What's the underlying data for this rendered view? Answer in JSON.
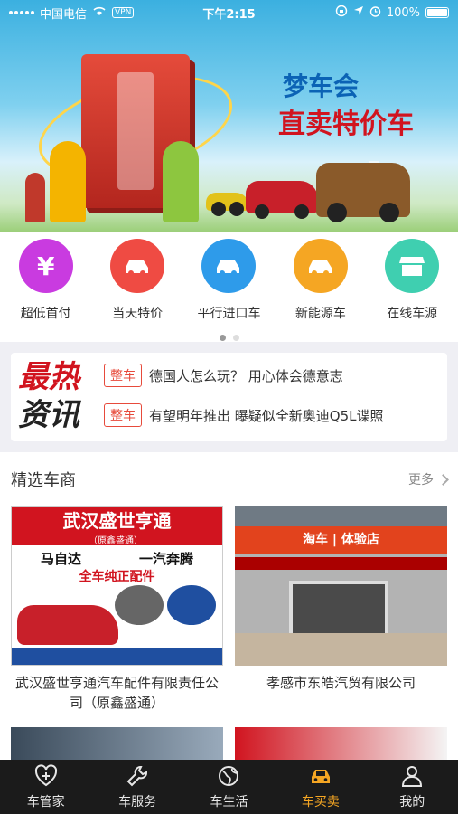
{
  "status_bar": {
    "carrier": "中国电信",
    "vpn": "VPN",
    "time": "下午2:15",
    "battery": "100%"
  },
  "banner": {
    "title_line1": "梦车会",
    "title_line2": "直卖特价车"
  },
  "categories": [
    {
      "label": "超低首付",
      "icon": "yen-icon",
      "color": "#c93be0"
    },
    {
      "label": "当天特价",
      "icon": "car-price-icon",
      "color": "#ef4b43"
    },
    {
      "label": "平行进口车",
      "icon": "car-import-icon",
      "color": "#2e9bea"
    },
    {
      "label": "新能源车",
      "icon": "car-energy-icon",
      "color": "#f5a623"
    },
    {
      "label": "在线车源",
      "icon": "store-icon",
      "color": "#3fcfb0"
    }
  ],
  "news": {
    "logo_line1": "最热",
    "logo_line2": "资讯",
    "items": [
      {
        "tag": "整车",
        "text": "德国人怎么玩？ 用心体会德意志"
      },
      {
        "tag": "整车",
        "text": "有望明年推出 曝疑似全新奥迪Q5L谍照"
      }
    ]
  },
  "dealers": {
    "title": "精选车商",
    "more": "更多",
    "items": [
      {
        "name": "武汉盛世亨通汽车配件有限责任公司（原鑫盛通）",
        "image": {
          "header": "武汉盛世亨通",
          "subheader": "（原鑫盛通）",
          "brand1": "马自达",
          "brand2": "一汽奔腾",
          "parts": "全车纯正配件"
        }
      },
      {
        "name": "孝感市东皓汽贸有限公司",
        "image": {
          "sign": "淘车 | 体验店"
        }
      }
    ]
  },
  "tabbar": [
    {
      "label": "车管家",
      "icon": "heart-plus-icon",
      "active": false
    },
    {
      "label": "车服务",
      "icon": "wrench-icon",
      "active": false
    },
    {
      "label": "车生活",
      "icon": "globe-icon",
      "active": false
    },
    {
      "label": "车买卖",
      "icon": "car-icon",
      "active": true
    },
    {
      "label": "我的",
      "icon": "user-icon",
      "active": false
    }
  ],
  "colors": {
    "accent": "#f5a623",
    "tag_red": "#e74a3b",
    "tabbar_bg": "#1b1b1b"
  }
}
